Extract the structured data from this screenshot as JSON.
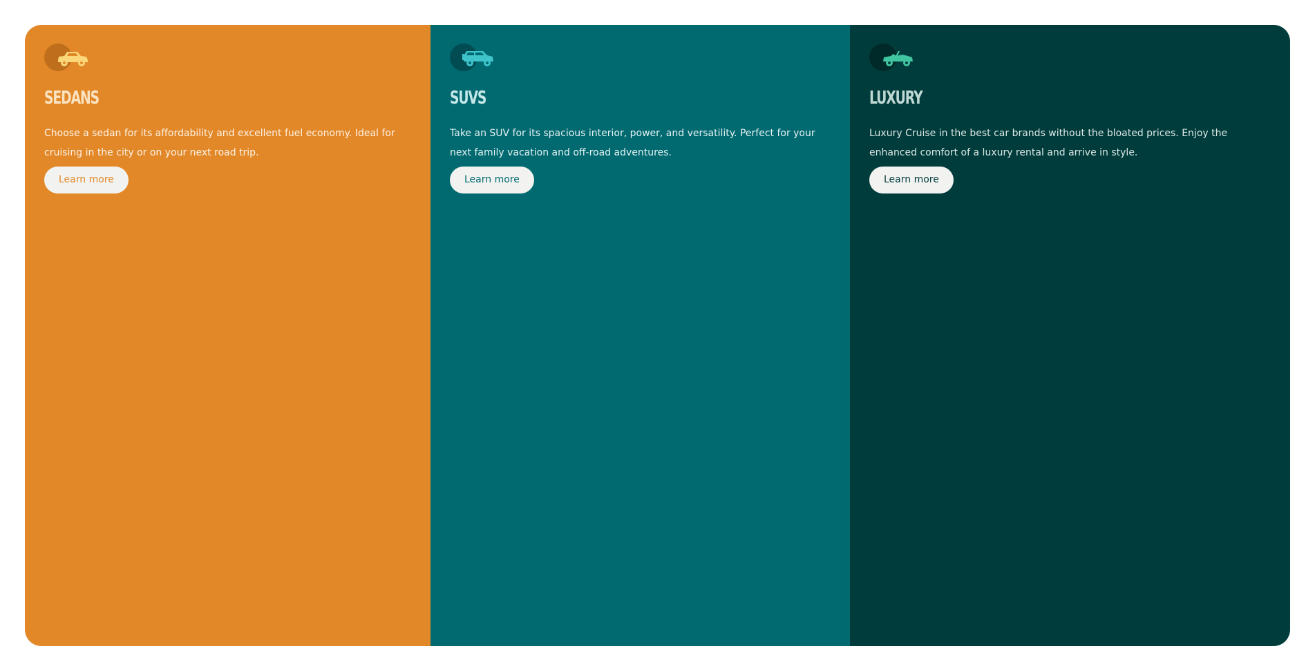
{
  "cards": [
    {
      "title": "SEDANS",
      "description": "Choose a sedan for its affordability and excellent fuel economy. Ideal for cruising in the city or on your next road trip.",
      "button_label": "Learn more",
      "icon": "sedan-car-icon",
      "colors": {
        "background": "#e28829",
        "icon_circle": "#bf6f1c",
        "icon": "#fbd77a",
        "title": "#fbe3c2",
        "text": "#fdf2e4",
        "button_text": "#e28829"
      }
    },
    {
      "title": "SUVS",
      "description": "Take an SUV for its spacious interior, power, and versatility. Perfect for your next family vacation and off-road adventures.",
      "button_label": "Learn more",
      "icon": "suv-car-icon",
      "colors": {
        "background": "#016970",
        "icon_circle": "#014c52",
        "icon": "#3fc4cc",
        "title": "#c4e7e8",
        "text": "#e4f3f3",
        "button_text": "#016970"
      }
    },
    {
      "title": "LUXURY",
      "description": "Luxury Cruise in the best car brands without the bloated prices. Enjoy the enhanced comfort of a luxury rental and arrive in style.",
      "button_label": "Learn more",
      "icon": "luxury-convertible-car-icon",
      "colors": {
        "background": "#003c3b",
        "icon_circle": "#002a29",
        "icon": "#3fc59f",
        "title": "#bfd8d4",
        "text": "#dbe8e6",
        "button_text": "#003c3b"
      }
    }
  ]
}
